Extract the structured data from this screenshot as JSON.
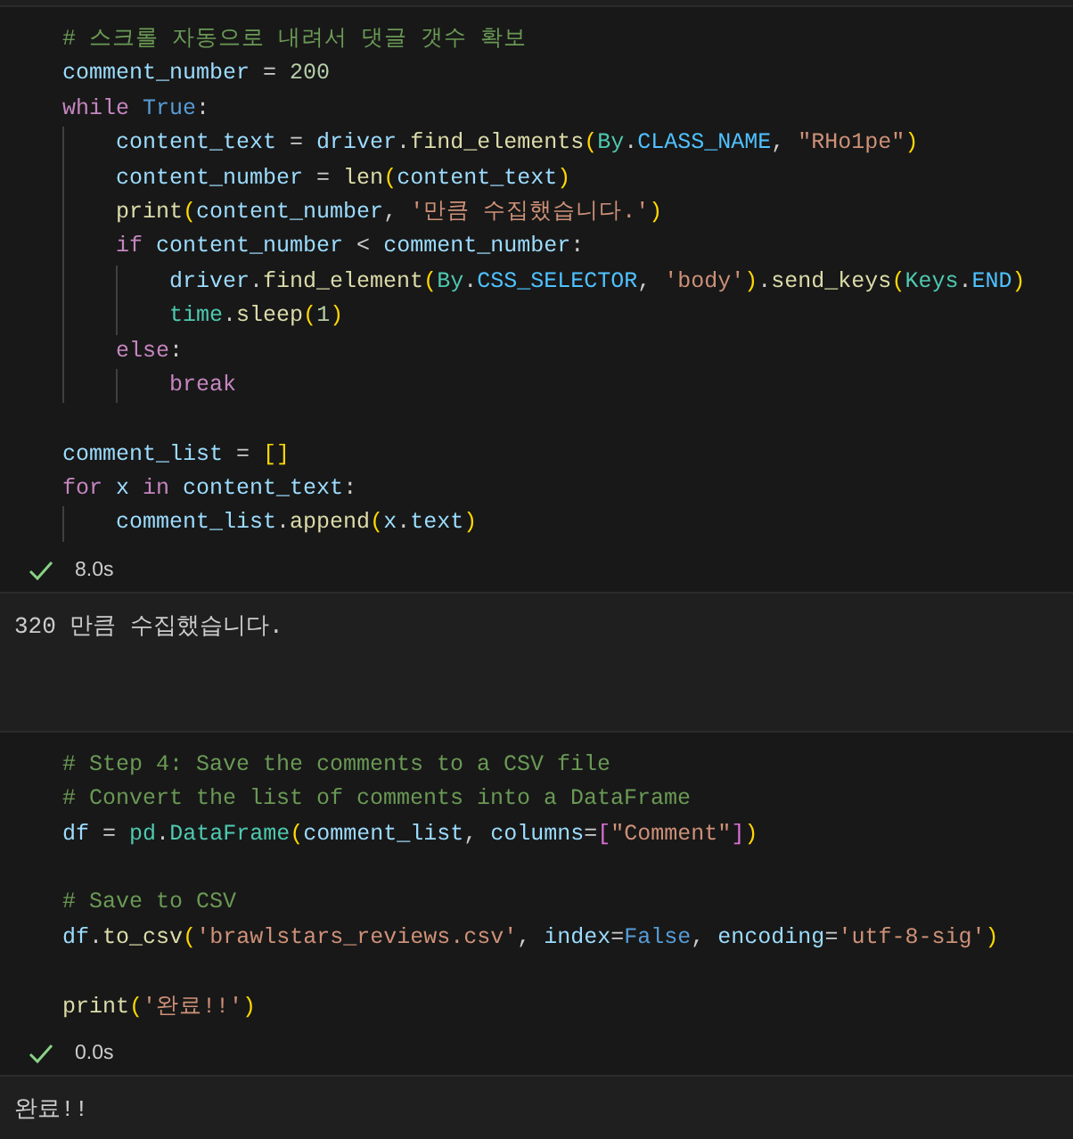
{
  "cells": [
    {
      "lines": [
        {
          "kind": "code",
          "tokens": [
            {
              "kind": "comment",
              "text": "# 스크롤 자동으로 내려서 댓글 갯수 확보"
            }
          ]
        },
        {
          "kind": "code",
          "tokens": [
            {
              "kind": "var",
              "text": "comment_number"
            },
            {
              "kind": "plain",
              "text": " = "
            },
            {
              "kind": "number",
              "text": "200"
            }
          ]
        },
        {
          "kind": "code",
          "tokens": [
            {
              "kind": "keyword",
              "text": "while"
            },
            {
              "kind": "const",
              "text": " True"
            },
            {
              "kind": "plain",
              "text": ":"
            }
          ],
          "children": [
            {
              "kind": "code",
              "tokens": [
                {
                  "kind": "var",
                  "text": "content_text"
                },
                {
                  "kind": "plain",
                  "text": " = "
                },
                {
                  "kind": "var",
                  "text": "driver"
                },
                {
                  "kind": "plain",
                  "text": "."
                },
                {
                  "kind": "func",
                  "text": "find_elements"
                },
                {
                  "kind": "paren",
                  "text": "("
                },
                {
                  "kind": "class",
                  "text": "By"
                },
                {
                  "kind": "plain",
                  "text": "."
                },
                {
                  "kind": "constvar",
                  "text": "CLASS_NAME"
                },
                {
                  "kind": "plain",
                  "text": ", "
                },
                {
                  "kind": "string",
                  "text": "\"RHo1pe\""
                },
                {
                  "kind": "paren",
                  "text": ")"
                }
              ]
            },
            {
              "kind": "code",
              "tokens": [
                {
                  "kind": "var",
                  "text": "content_number"
                },
                {
                  "kind": "plain",
                  "text": " = "
                },
                {
                  "kind": "func",
                  "text": "len"
                },
                {
                  "kind": "paren",
                  "text": "("
                },
                {
                  "kind": "var",
                  "text": "content_text"
                },
                {
                  "kind": "paren",
                  "text": ")"
                }
              ]
            },
            {
              "kind": "code",
              "tokens": [
                {
                  "kind": "func",
                  "text": "print"
                },
                {
                  "kind": "paren",
                  "text": "("
                },
                {
                  "kind": "var",
                  "text": "content_number"
                },
                {
                  "kind": "plain",
                  "text": ", "
                },
                {
                  "kind": "string",
                  "text": "'만큼 수집했습니다.'"
                },
                {
                  "kind": "paren",
                  "text": ")"
                }
              ]
            },
            {
              "kind": "code",
              "tokens": [
                {
                  "kind": "keyword",
                  "text": "if"
                },
                {
                  "kind": "var",
                  "text": " content_number"
                },
                {
                  "kind": "plain",
                  "text": " < "
                },
                {
                  "kind": "var",
                  "text": "comment_number"
                },
                {
                  "kind": "plain",
                  "text": ":"
                }
              ],
              "children": [
                {
                  "kind": "code",
                  "tokens": [
                    {
                      "kind": "var",
                      "text": "driver"
                    },
                    {
                      "kind": "plain",
                      "text": "."
                    },
                    {
                      "kind": "func",
                      "text": "find_element"
                    },
                    {
                      "kind": "paren",
                      "text": "("
                    },
                    {
                      "kind": "class",
                      "text": "By"
                    },
                    {
                      "kind": "plain",
                      "text": "."
                    },
                    {
                      "kind": "constvar",
                      "text": "CSS_SELECTOR"
                    },
                    {
                      "kind": "plain",
                      "text": ", "
                    },
                    {
                      "kind": "string",
                      "text": "'body'"
                    },
                    {
                      "kind": "paren",
                      "text": ")"
                    },
                    {
                      "kind": "plain",
                      "text": "."
                    },
                    {
                      "kind": "func",
                      "text": "send_keys"
                    },
                    {
                      "kind": "paren",
                      "text": "("
                    },
                    {
                      "kind": "class",
                      "text": "Keys"
                    },
                    {
                      "kind": "plain",
                      "text": "."
                    },
                    {
                      "kind": "constvar",
                      "text": "END"
                    },
                    {
                      "kind": "paren",
                      "text": ")"
                    }
                  ]
                },
                {
                  "kind": "code",
                  "tokens": [
                    {
                      "kind": "class",
                      "text": "time"
                    },
                    {
                      "kind": "plain",
                      "text": "."
                    },
                    {
                      "kind": "func",
                      "text": "sleep"
                    },
                    {
                      "kind": "paren",
                      "text": "("
                    },
                    {
                      "kind": "number",
                      "text": "1"
                    },
                    {
                      "kind": "paren",
                      "text": ")"
                    }
                  ]
                }
              ]
            },
            {
              "kind": "code",
              "tokens": [
                {
                  "kind": "keyword",
                  "text": "else"
                },
                {
                  "kind": "plain",
                  "text": ":"
                }
              ],
              "children": [
                {
                  "kind": "code",
                  "tokens": [
                    {
                      "kind": "keyword",
                      "text": "break"
                    }
                  ]
                }
              ]
            }
          ]
        },
        {
          "kind": "blank"
        },
        {
          "kind": "code",
          "tokens": [
            {
              "kind": "var",
              "text": "comment_list"
            },
            {
              "kind": "plain",
              "text": " = "
            },
            {
              "kind": "paren",
              "text": "[]"
            }
          ]
        },
        {
          "kind": "code",
          "tokens": [
            {
              "kind": "keyword",
              "text": "for"
            },
            {
              "kind": "var",
              "text": " x"
            },
            {
              "kind": "keyword",
              "text": " in"
            },
            {
              "kind": "var",
              "text": " content_text"
            },
            {
              "kind": "plain",
              "text": ":"
            }
          ],
          "children": [
            {
              "kind": "code",
              "tokens": [
                {
                  "kind": "var",
                  "text": "comment_list"
                },
                {
                  "kind": "plain",
                  "text": "."
                },
                {
                  "kind": "func",
                  "text": "append"
                },
                {
                  "kind": "paren",
                  "text": "("
                },
                {
                  "kind": "var",
                  "text": "x"
                },
                {
                  "kind": "plain",
                  "text": "."
                },
                {
                  "kind": "var",
                  "text": "text"
                },
                {
                  "kind": "paren",
                  "text": ")"
                }
              ]
            }
          ]
        }
      ],
      "status": {
        "success": true,
        "time": "8.0s"
      },
      "output": "320 만큼 수집했습니다."
    },
    {
      "lines": [
        {
          "kind": "code",
          "tokens": [
            {
              "kind": "comment",
              "text": "# Step 4: Save the comments to a CSV file"
            }
          ]
        },
        {
          "kind": "code",
          "tokens": [
            {
              "kind": "comment",
              "text": "# Convert the list of comments into a DataFrame"
            }
          ]
        },
        {
          "kind": "code",
          "tokens": [
            {
              "kind": "var",
              "text": "df"
            },
            {
              "kind": "plain",
              "text": " = "
            },
            {
              "kind": "class",
              "text": "pd"
            },
            {
              "kind": "plain",
              "text": "."
            },
            {
              "kind": "class",
              "text": "DataFrame"
            },
            {
              "kind": "paren",
              "text": "("
            },
            {
              "kind": "var",
              "text": "comment_list"
            },
            {
              "kind": "plain",
              "text": ", "
            },
            {
              "kind": "var",
              "text": "columns"
            },
            {
              "kind": "plain",
              "text": "="
            },
            {
              "kind": "bracket",
              "text": "["
            },
            {
              "kind": "string",
              "text": "\"Comment\""
            },
            {
              "kind": "bracket",
              "text": "]"
            },
            {
              "kind": "paren",
              "text": ")"
            }
          ]
        },
        {
          "kind": "blank"
        },
        {
          "kind": "code",
          "tokens": [
            {
              "kind": "comment",
              "text": "# Save to CSV"
            }
          ]
        },
        {
          "kind": "code",
          "tokens": [
            {
              "kind": "var",
              "text": "df"
            },
            {
              "kind": "plain",
              "text": "."
            },
            {
              "kind": "func",
              "text": "to_csv"
            },
            {
              "kind": "paren",
              "text": "("
            },
            {
              "kind": "string",
              "text": "'brawlstars_reviews.csv'"
            },
            {
              "kind": "plain",
              "text": ", "
            },
            {
              "kind": "var",
              "text": "index"
            },
            {
              "kind": "plain",
              "text": "="
            },
            {
              "kind": "const",
              "text": "False"
            },
            {
              "kind": "plain",
              "text": ", "
            },
            {
              "kind": "var",
              "text": "encoding"
            },
            {
              "kind": "plain",
              "text": "="
            },
            {
              "kind": "string",
              "text": "'utf-8-sig'"
            },
            {
              "kind": "paren",
              "text": ")"
            }
          ]
        },
        {
          "kind": "blank"
        },
        {
          "kind": "code",
          "tokens": [
            {
              "kind": "func",
              "text": "print"
            },
            {
              "kind": "paren",
              "text": "("
            },
            {
              "kind": "string",
              "text": "'완료!!'"
            },
            {
              "kind": "paren",
              "text": ")"
            }
          ]
        }
      ],
      "status": {
        "success": true,
        "time": "0.0s"
      },
      "output": "완료!!"
    }
  ]
}
